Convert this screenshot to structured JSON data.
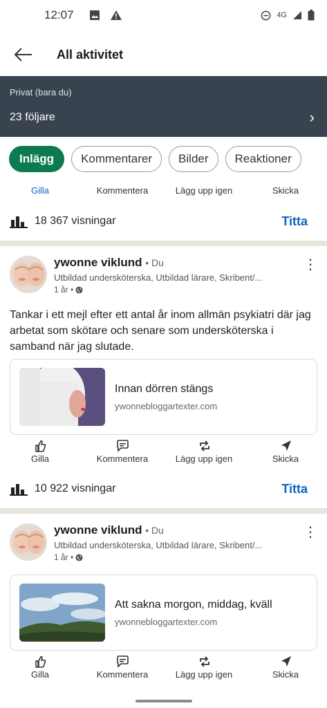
{
  "status_bar": {
    "time": "12:07",
    "network": "4G"
  },
  "app_bar": {
    "title": "All aktivitet"
  },
  "banner": {
    "privacy": "Privat (bara du)",
    "followers": "23 följare"
  },
  "chips": [
    "Inlägg",
    "Kommentarer",
    "Bilder",
    "Reaktioner"
  ],
  "actions": {
    "like": "Gilla",
    "comment": "Kommentera",
    "repost": "Lägg upp igen",
    "send": "Skicka"
  },
  "top_views": {
    "count": "18 367 visningar",
    "link": "Titta"
  },
  "posts": [
    {
      "author": "ywonne viklund",
      "degree": "• Du",
      "headline": "Utbildad undersköterska, Utbildad lärare, Skribent/...",
      "time": "1 år •",
      "text": "Tankar i ett mejl efter ett antal år inom allmän psykiatri där jag arbetat som skötare och senare som undersköterska i samband när jag slutade.",
      "link_title": "Innan dörren stängs",
      "link_domain": "ywonnebloggartexter.com",
      "views": "10 922 visningar",
      "views_link": "Titta"
    },
    {
      "author": "ywonne viklund",
      "degree": "• Du",
      "headline": "Utbildad undersköterska, Utbildad lärare, Skribent/...",
      "time": "1 år •",
      "link_title": "Att sakna morgon, middag, kväll",
      "link_domain": "ywonnebloggartexter.com"
    }
  ],
  "colors": {
    "accent": "#0a66c2",
    "chip_active": "#0d7a4f",
    "banner": "#38434f",
    "divider": "#e8e4de"
  }
}
